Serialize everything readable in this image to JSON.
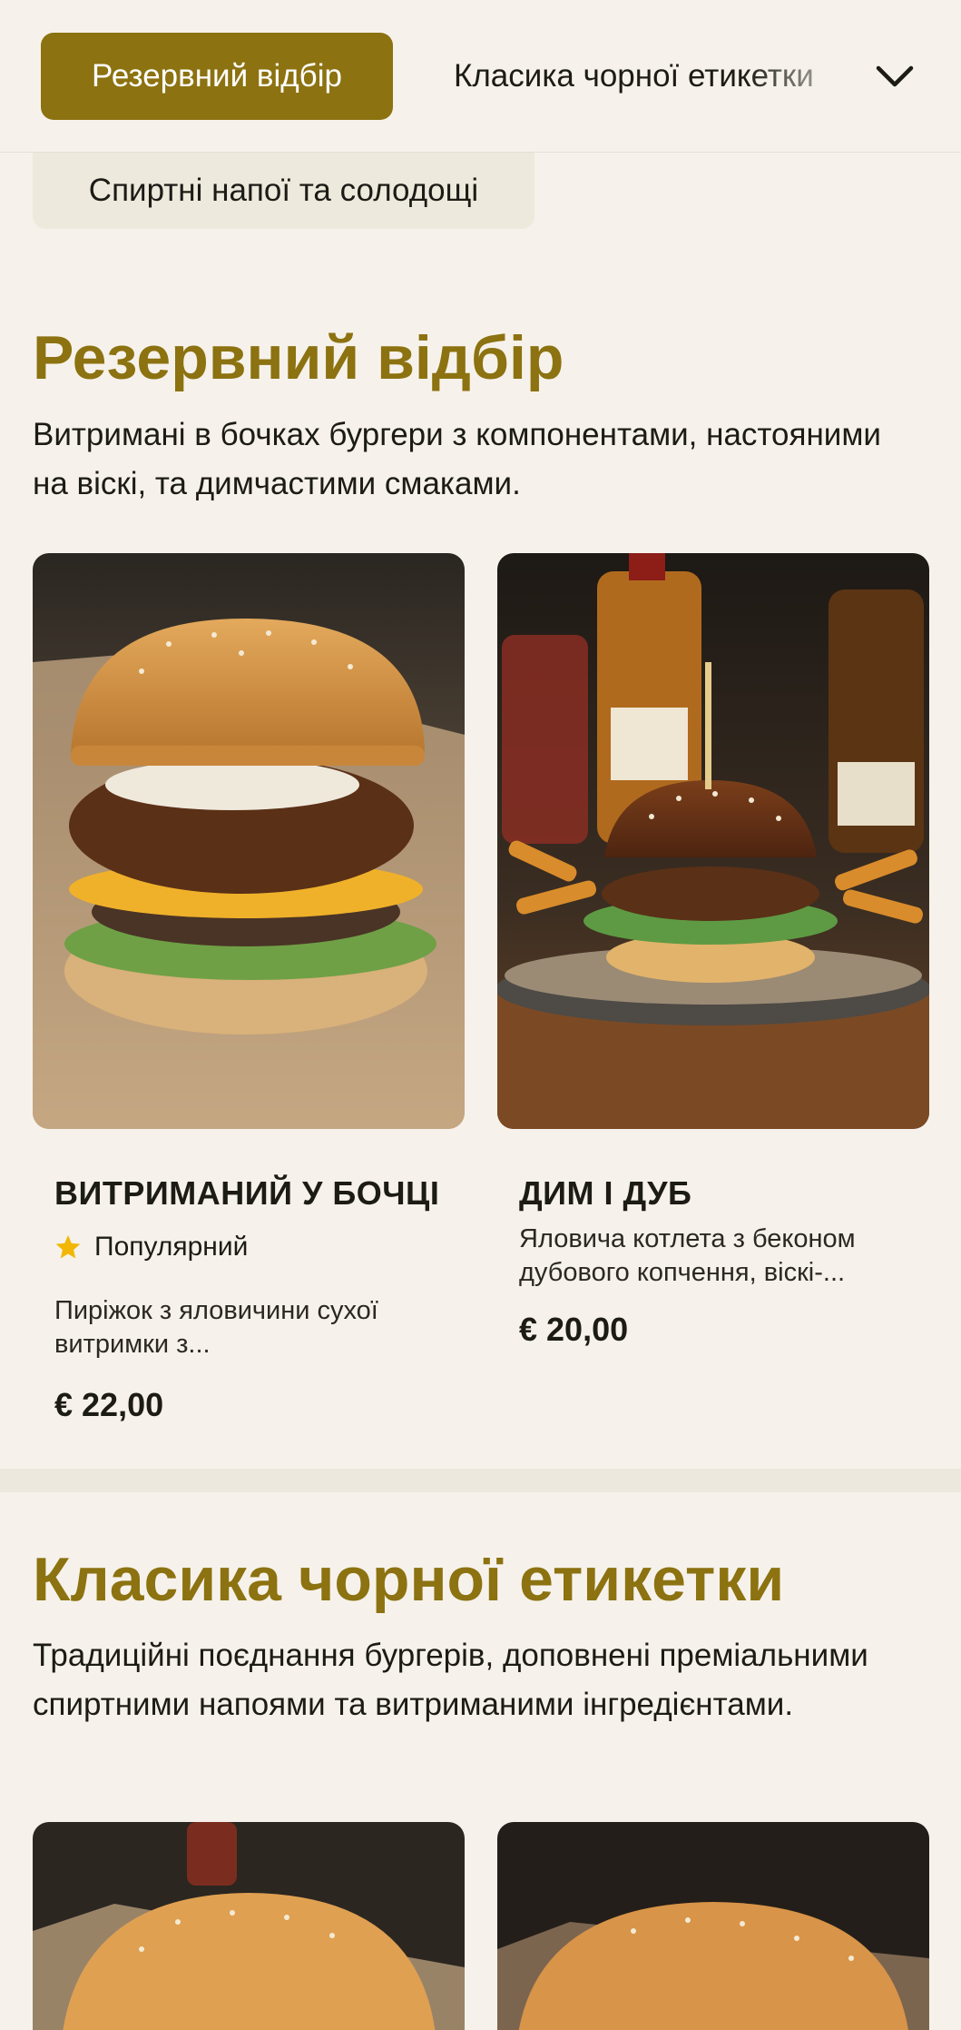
{
  "nav": {
    "active_tab": "Резервний відбір",
    "next_tab": "Класика чорної етикетки",
    "category_tab": "Спиртні напої та солодощі"
  },
  "sections": [
    {
      "title": "Резервний відбір",
      "description": "Витримані в бочках бургери з компонентами, настояними на віскі, та димчастими смаками.",
      "items": [
        {
          "name": "ВИТРИМАНИЙ У БОЧЦІ",
          "badge": "Популярний",
          "description": "Пиріжок з яловичини сухої витримки з...",
          "price": "€ 22,00"
        },
        {
          "name": "ДИМ І ДУБ",
          "description": "Яловича котлета з беконом дубового копчення, віскі-...",
          "price": "€ 20,00"
        }
      ]
    },
    {
      "title": "Класика чорної етикетки",
      "description": "Традиційні поєднання бургерів, доповнені преміальними спиртними напоями та витриманими інгредієнтами."
    }
  ],
  "icons": {
    "dropdown": "chevron-down-icon",
    "badge": "star-icon"
  },
  "colors": {
    "accent": "#8c7210",
    "background": "#f6f2eb",
    "category_tab": "#ede9dc",
    "star": "#f2b705",
    "text": "#1d1b16"
  }
}
